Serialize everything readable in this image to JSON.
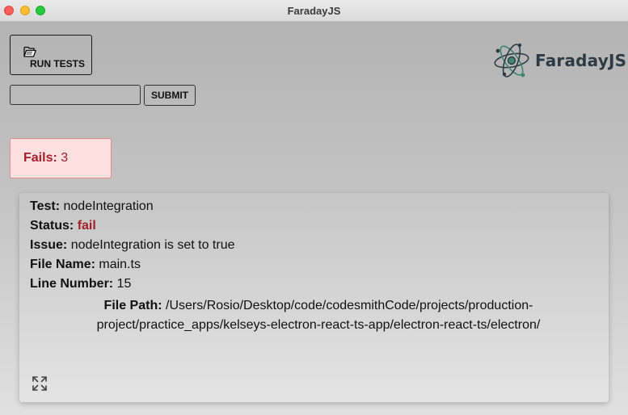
{
  "window": {
    "title": "FaradayJS"
  },
  "toolbar": {
    "run_tests_label": "RUN TESTS",
    "run_tests_icon": "folder-open-icon",
    "path_input_value": "",
    "path_input_placeholder": "",
    "submit_label": "SUBMIT"
  },
  "brand": {
    "name": "FaradayJS",
    "logo_icon": "atom-icon"
  },
  "summary": {
    "fails_label": "Fails:",
    "fails_count": "3"
  },
  "result": {
    "test_label": "Test:",
    "test_value": "nodeIntegration",
    "status_label": "Status:",
    "status_value": "fail",
    "issue_label": "Issue:",
    "issue_value": "nodeIntegration is set to true",
    "file_name_label": "File Name:",
    "file_name_value": "main.ts",
    "line_number_label": "Line Number:",
    "line_number_value": "15",
    "file_path_label": "File Path:",
    "file_path_value": "/Users/Rosio/Desktop/code/codesmithCode/projects/production-project/practice_apps/kelseys-electron-react-ts-app/electron-react-ts/electron/",
    "expand_icon": "expand-icon"
  },
  "colors": {
    "fail_red": "#a3202b",
    "fails_box_bg": "#fde0e0",
    "fails_box_border": "#e58b8f",
    "logo_dark": "#2e3b44",
    "logo_teal": "#3e8577"
  }
}
